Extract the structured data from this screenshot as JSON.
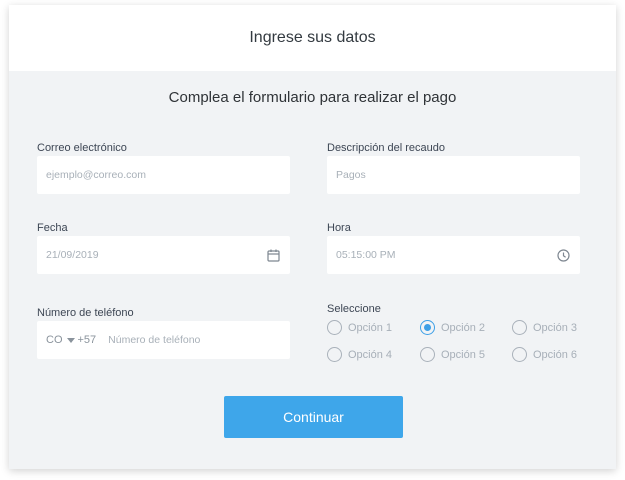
{
  "header": {
    "title": "Ingrese sus datos"
  },
  "form": {
    "subtitle": "Complea el formulario para realizar el pago",
    "email": {
      "label": "Correo electrónico",
      "placeholder": "ejemplo@correo.com"
    },
    "description": {
      "label": "Descripción del recaudo",
      "placeholder": "Pagos"
    },
    "date": {
      "label": "Fecha",
      "value": "21/09/2019",
      "icon": "calendar-icon"
    },
    "time": {
      "label": "Hora",
      "value": "05:15:00 PM",
      "icon": "clock-icon"
    },
    "phone": {
      "label": "Número de teléfono",
      "country": "CO",
      "dial_code": "+57",
      "placeholder": "Número de teléfono"
    },
    "select": {
      "label": "Seleccione",
      "options": [
        "Opción 1",
        "Opción 2",
        "Opción 3",
        "Opción 4",
        "Opción 5",
        "Opción 6"
      ],
      "selected": "Opción 2"
    },
    "submit_label": "Continuar"
  },
  "colors": {
    "accent": "#3ea6ea",
    "background": "#f1f3f5",
    "header": "#ffffff"
  }
}
